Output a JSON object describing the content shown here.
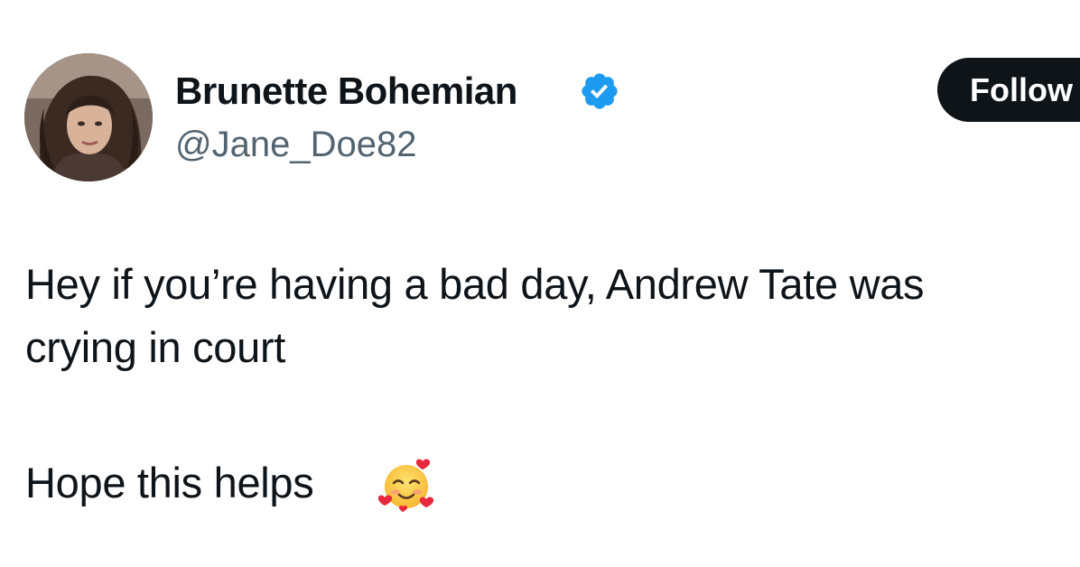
{
  "tweet": {
    "author": {
      "display_name": "Brunette Bohemian",
      "handle": "@Jane_Doe82",
      "verified": true,
      "avatar_icon": "profile-photo"
    },
    "follow_label": "Follow",
    "text_lines": [
      "Hey if you’re having a bad day, Andrew Tate was",
      "crying in court",
      "Hope this helps"
    ],
    "emoji_icon": "smiling-face-with-hearts-emoji"
  },
  "colors": {
    "follow_button_bg": "#0f1419",
    "verified_badge": "#1d9bf0",
    "handle_text": "#536471"
  }
}
